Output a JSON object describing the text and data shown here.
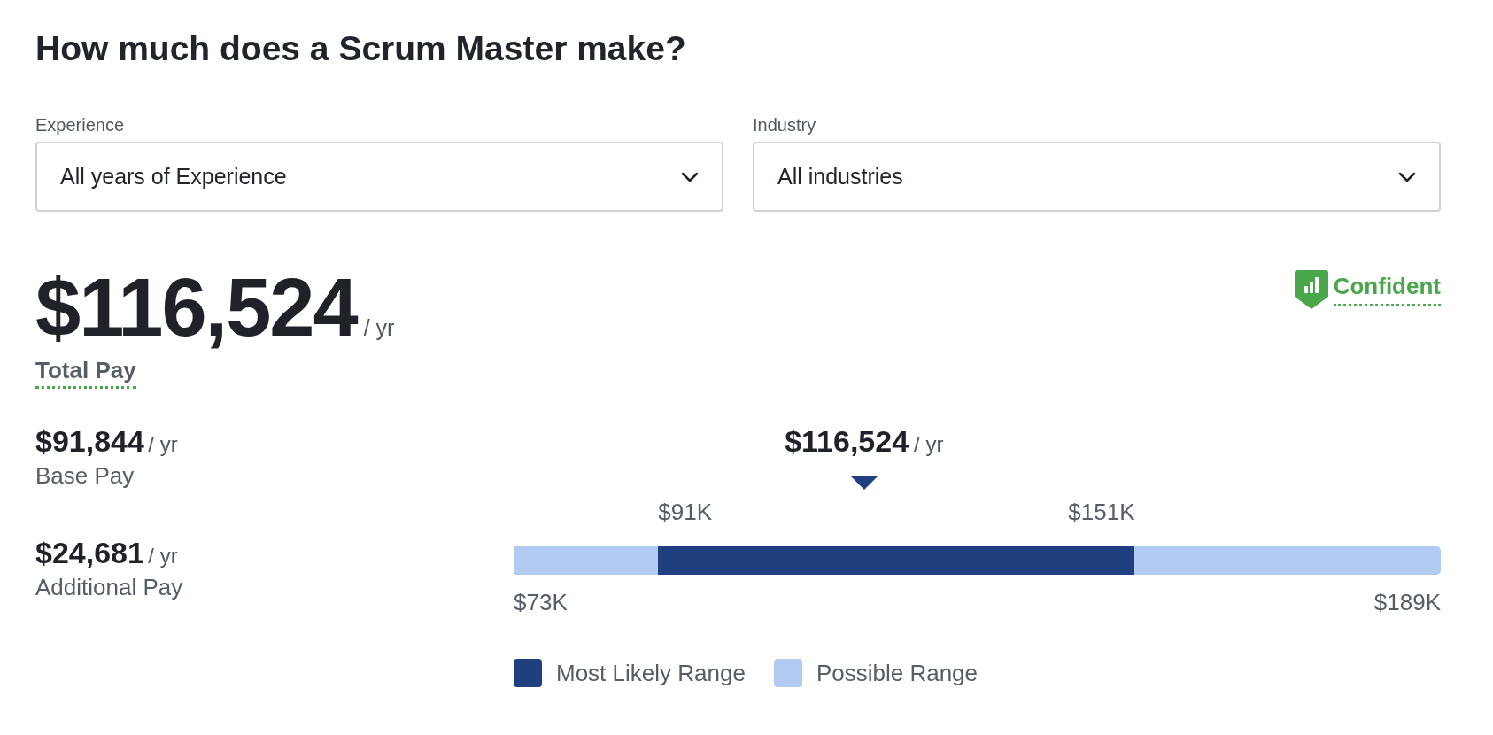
{
  "title": "How much does a Scrum Master make?",
  "filters": [
    {
      "label": "Experience",
      "value": "All years of Experience"
    },
    {
      "label": "Industry",
      "value": "All industries"
    }
  ],
  "total": {
    "amount": "$116,524",
    "unit": "/ yr",
    "label": "Total Pay"
  },
  "confidence": {
    "label": "Confident"
  },
  "breakdown": [
    {
      "amount": "$91,844",
      "unit": "/ yr",
      "label": "Base Pay"
    },
    {
      "amount": "$24,681",
      "unit": "/ yr",
      "label": "Additional Pay"
    }
  ],
  "range": {
    "marker": {
      "amount": "$116,524",
      "unit": "/ yr",
      "level": 0.378
    },
    "likely_range": {
      "start_label": "$91K",
      "end_label": "$151K",
      "level": 0.67
    },
    "lower_possible": {
      "level": 0.156
    },
    "min_label": "$73K",
    "max_label": "$189K"
  },
  "legend": [
    {
      "label": "Most Likely Range",
      "color": "#1f3f7e"
    },
    {
      "label": "Possible Range",
      "color": "#b2cbf2"
    }
  ]
}
